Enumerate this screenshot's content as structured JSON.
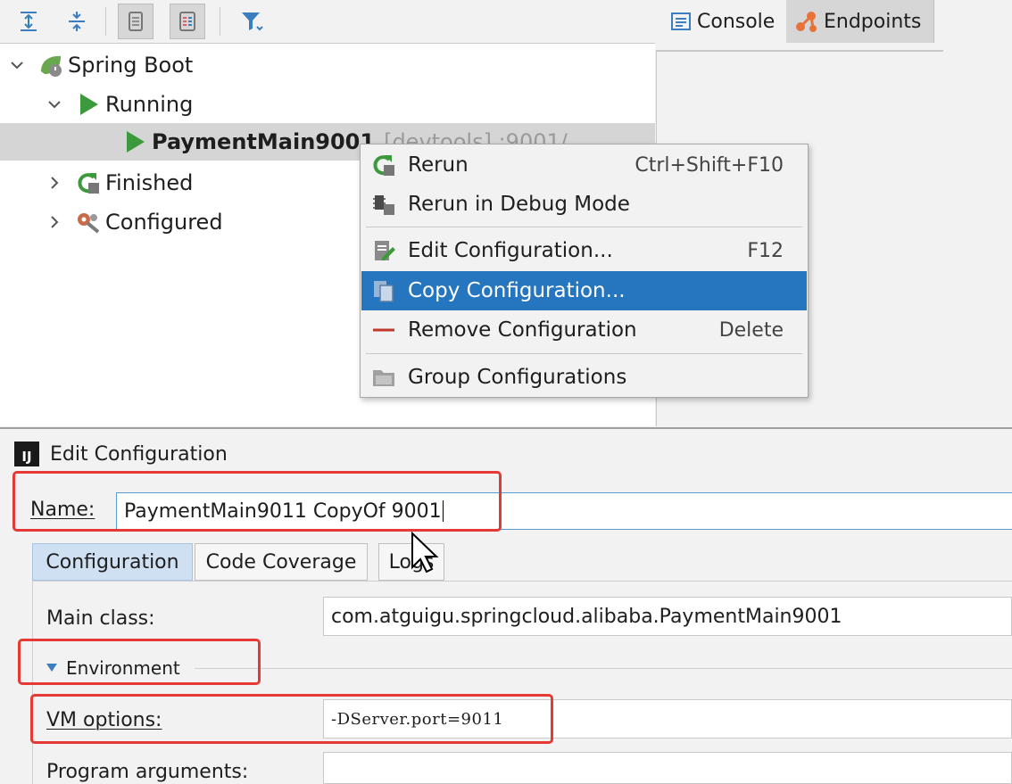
{
  "toolbar": {
    "icons": [
      "expand-all-icon",
      "collapse-all-icon",
      "group-by-service-icon",
      "group-by-type-icon",
      "filter-icon"
    ]
  },
  "tree": {
    "root": {
      "label": "Spring Boot"
    },
    "running": {
      "label": "Running"
    },
    "app": {
      "name": "PaymentMain9001",
      "suffix": "[devtools] :9001/"
    },
    "finished": {
      "label": "Finished"
    },
    "configured": {
      "label": "Configured"
    }
  },
  "panel_tabs": [
    {
      "label": "Console"
    },
    {
      "label": "Endpoints"
    }
  ],
  "context_menu": {
    "items": [
      {
        "label": "Rerun",
        "shortcut": "Ctrl+Shift+F10"
      },
      {
        "label": "Rerun in Debug Mode",
        "shortcut": ""
      },
      {
        "label": "Edit Configuration...",
        "shortcut": "F12"
      },
      {
        "label": "Copy Configuration...",
        "shortcut": ""
      },
      {
        "label": "Remove Configuration",
        "shortcut": "Delete"
      },
      {
        "label": "Group Configurations",
        "shortcut": ""
      }
    ],
    "highlight_color": "#2675bf"
  },
  "dialog": {
    "title": "Edit Configuration",
    "logo_text": "IJ",
    "name_label": "Name:",
    "name_value": "PaymentMain9011 CopyOf 9001",
    "tabs": [
      {
        "label": "Configuration"
      },
      {
        "label": "Code Coverage"
      },
      {
        "label": "Logs"
      }
    ],
    "main_class_label": "Main class:",
    "main_class_value": "com.atguigu.springcloud.alibaba.PaymentMain9001",
    "environment_label": "Environment",
    "vm_options_label": "VM options:",
    "vm_options_value": "-DServer.port=9011",
    "program_args_label": "Program arguments:",
    "program_args_value": ""
  },
  "annotation_color": "#e53935"
}
